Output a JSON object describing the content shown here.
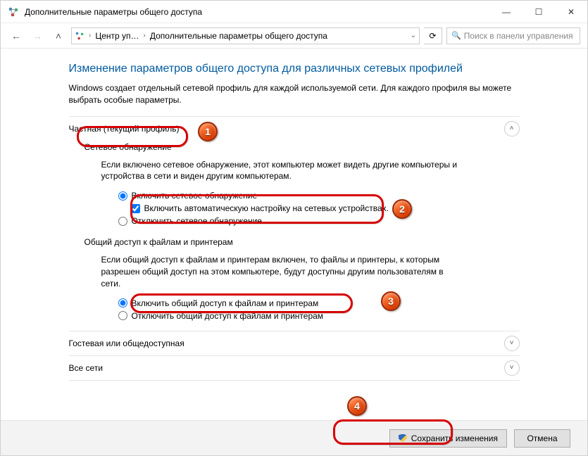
{
  "window": {
    "title": "Дополнительные параметры общего доступа"
  },
  "breadcrumb": {
    "level1": "Центр уп…",
    "level2": "Дополнительные параметры общего доступа"
  },
  "search": {
    "placeholder": "Поиск в панели управления"
  },
  "page": {
    "title": "Изменение параметров общего доступа для различных сетевых профилей",
    "desc": "Windows создает отдельный сетевой профиль для каждой используемой сети. Для каждого профиля вы можете выбрать особые параметры."
  },
  "sections": {
    "private": {
      "label": "Частная (текущий профиль)",
      "discovery": {
        "heading": "Сетевое обнаружение",
        "desc": "Если включено сетевое обнаружение, этот компьютер может видеть другие компьютеры и устройства в сети и виден другим компьютерам.",
        "opt_on": "Включить сетевое обнаружение",
        "opt_auto": "Включить автоматическую настройку на сетевых устройствах.",
        "opt_off": "Отключить сетевое обнаружение"
      },
      "sharing": {
        "heading": "Общий доступ к файлам и принтерам",
        "desc": "Если общий доступ к файлам и принтерам включен, то файлы и принтеры, к которым разрешен общий доступ на этом компьютере, будут доступны другим пользователям в сети.",
        "opt_on": "Включить общий доступ к файлам и принтерам",
        "opt_off": "Отключить общий доступ к файлам и принтерам"
      }
    },
    "guest": {
      "label": "Гостевая или общедоступная"
    },
    "all": {
      "label": "Все сети"
    }
  },
  "footer": {
    "save": "Сохранить изменения",
    "cancel": "Отмена"
  },
  "badges": {
    "b1": "1",
    "b2": "2",
    "b3": "3",
    "b4": "4"
  }
}
